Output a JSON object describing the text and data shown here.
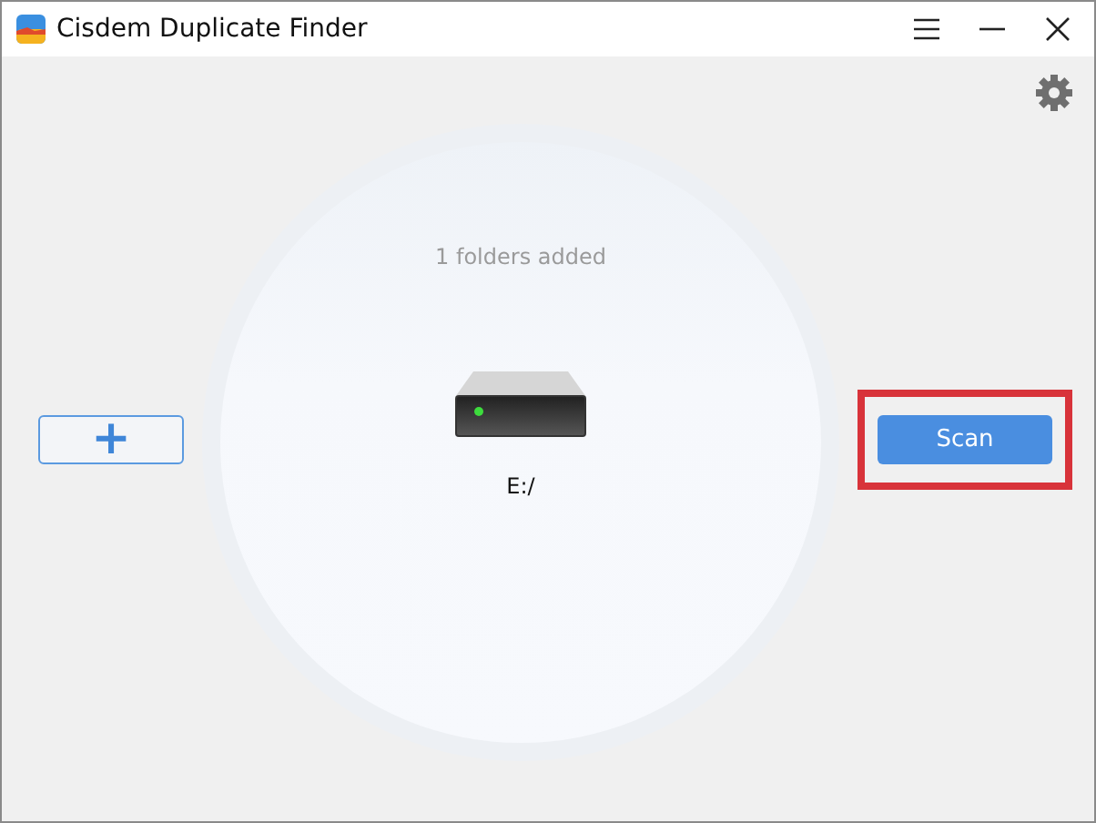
{
  "window": {
    "title": "Cisdem Duplicate Finder"
  },
  "status": {
    "text": "1 folders added"
  },
  "folders": [
    {
      "label": "E:/"
    }
  ],
  "buttons": {
    "add": "+",
    "scan": "Scan",
    "scan_highlighted": true
  }
}
